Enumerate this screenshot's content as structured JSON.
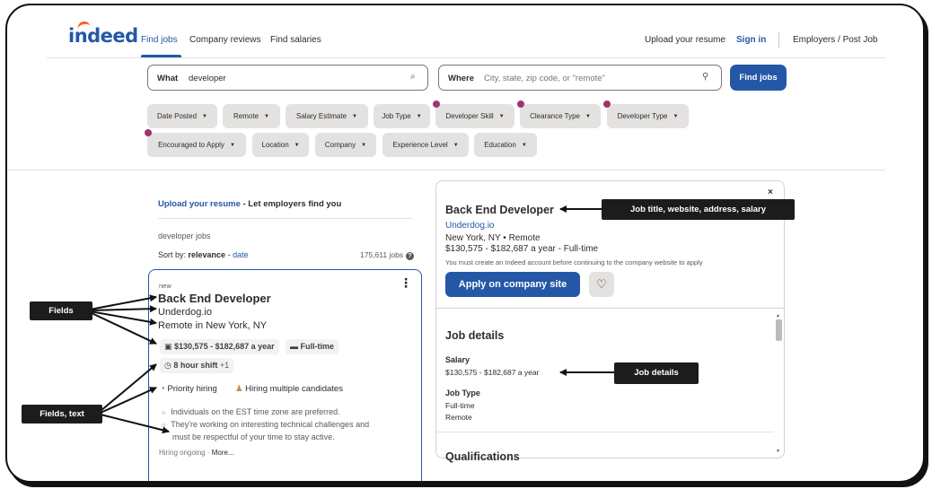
{
  "header": {
    "logo": "indeed",
    "nav": [
      "Find jobs",
      "Company reviews",
      "Find salaries"
    ],
    "upload_resume": "Upload your resume",
    "sign_in": "Sign in",
    "employers": "Employers / Post Job"
  },
  "search": {
    "what_label": "What",
    "what_value": "developer",
    "where_label": "Where",
    "where_placeholder": "City, state, zip code, or \"remote\"",
    "find_jobs": "Find jobs"
  },
  "filters": {
    "row1": [
      "Date Posted",
      "Remote",
      "Salary Estimate",
      "Job Type",
      "Developer Skill",
      "Clearance Type",
      "Developer Type"
    ],
    "row2": [
      "Encouraged to Apply",
      "Location",
      "Company",
      "Experience Level",
      "Education"
    ],
    "caret": "▼"
  },
  "results": {
    "upload_link": "Upload your resume",
    "upload_text": " - Let employers find you",
    "query_label": "developer jobs",
    "sort_label": "Sort by: ",
    "sort_active": "relevance",
    "sort_sep": " - ",
    "sort_other": "date",
    "job_count": "175,611 jobs",
    "help": "?"
  },
  "card": {
    "new_label": "new",
    "title": "Back End Developer",
    "company": "Underdog.io",
    "location": "Remote in New York, NY",
    "salary": "$130,575 - $182,687 a year",
    "job_type": "Full-time",
    "shift": "8 hour shift",
    "shift_more": "+1",
    "priority": "Priority hiring",
    "multiple": "Hiring multiple candidates",
    "bullet1": "Individuals on the EST time zone are preferred.",
    "bullet2": "They're working on interesting technical challenges and",
    "bullet2b": "must be respectful of your time to stay active.",
    "ongoing": "Hiring ongoing",
    "dot": "·",
    "more": "More..."
  },
  "panel": {
    "close": "×",
    "title": "Back End Developer",
    "company": "Underdog.io",
    "location": "New York, NY  •  Remote",
    "salary_line": "$130,575 - $182,687 a year  - Full-time",
    "note": "You must create an Indeed account before continuing to the company website to apply",
    "apply": "Apply on company site",
    "heart": "♡",
    "details_heading": "Job details",
    "salary_label": "Salary",
    "salary_value": "$130,575 - $182,687 a year",
    "jobtype_label": "Job Type",
    "jobtype_1": "Full-time",
    "jobtype_2": "Remote",
    "qualifications": "Qualifications"
  },
  "annotations": {
    "fields": "Fields",
    "fields_text": "Fields, text",
    "job_title_info": "Job title, website, address, salary",
    "job_details": "Job details"
  },
  "icons": {
    "search": "⌕",
    "pin": "⚲",
    "money": "▣",
    "briefcase": "▬",
    "clock": "◷",
    "priority": "◔",
    "people": "♟"
  },
  "colors": {
    "brand_blue": "#2557a7",
    "filter_dot": "#a1346d",
    "annotation_bg": "#1c1c1c"
  }
}
